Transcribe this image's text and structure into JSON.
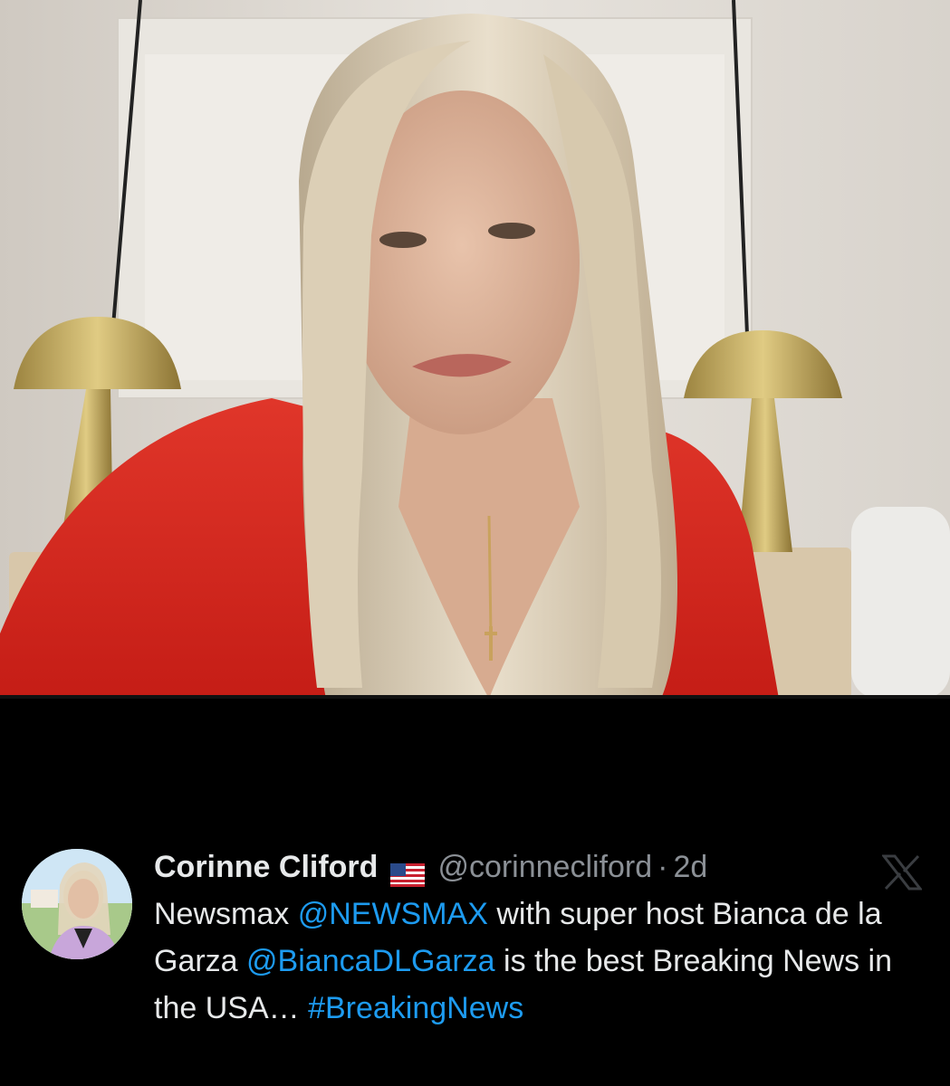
{
  "tweet": {
    "author_name": "Corinne Cliford",
    "flag_icon": "us-flag-icon",
    "handle": "@corinnecliford",
    "separator": "·",
    "time": "2d",
    "text_parts": [
      {
        "type": "text",
        "value": "Newsmax "
      },
      {
        "type": "mention",
        "value": "@NEWSMAX"
      },
      {
        "type": "text",
        "value": " with super host Bianca de la Garza "
      },
      {
        "type": "mention",
        "value": "@BiancaDLGarza"
      },
      {
        "type": "text",
        "value": " is the best Breaking News in the USA… "
      },
      {
        "type": "hashtag",
        "value": "#BreakingNews"
      }
    ],
    "brand_icon": "x-logo-icon"
  },
  "colors": {
    "background": "#000000",
    "text": "#e7e9ea",
    "secondary": "#8b9096",
    "link": "#1d9bf0",
    "jacket": "#d8261c"
  }
}
